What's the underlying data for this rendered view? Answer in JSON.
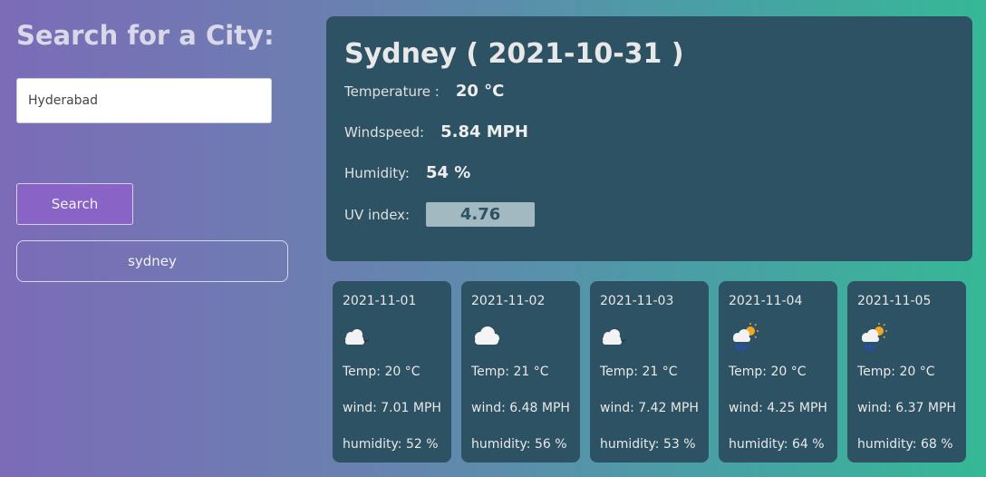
{
  "sidebar": {
    "title": "Search for a City:",
    "search_value": "Hyderabad",
    "search_button": "Search",
    "history": [
      "sydney"
    ]
  },
  "current": {
    "title": "Sydney ( 2021-10-31 )",
    "temperature_label": "Temperature :",
    "temperature_value": "20 °C",
    "wind_label": "Windspeed:",
    "wind_value": "5.84 MPH",
    "humidity_label": "Humidity:",
    "humidity_value": "54 %",
    "uv_label": "UV index:",
    "uv_value": "4.76",
    "uv_color": "#a3b9c2"
  },
  "forecast": [
    {
      "date": "2021-11-01",
      "icon": "partly-cloudy-night-icon",
      "temp": "Temp: 20 °C",
      "wind": "wind: 7.01 MPH",
      "humidity": "humidity: 52 %"
    },
    {
      "date": "2021-11-02",
      "icon": "cloud-icon",
      "temp": "Temp: 21 °C",
      "wind": "wind: 6.48 MPH",
      "humidity": "humidity: 56 %"
    },
    {
      "date": "2021-11-03",
      "icon": "partly-cloudy-night-icon",
      "temp": "Temp: 21 °C",
      "wind": "wind: 7.42 MPH",
      "humidity": "humidity: 53 %"
    },
    {
      "date": "2021-11-04",
      "icon": "sun-rain-icon",
      "temp": "Temp: 20 °C",
      "wind": "wind: 4.25 MPH",
      "humidity": "humidity: 64 %"
    },
    {
      "date": "2021-11-05",
      "icon": "sun-rain-icon",
      "temp": "Temp: 20 °C",
      "wind": "wind: 6.37 MPH",
      "humidity": "humidity: 68 %"
    }
  ]
}
